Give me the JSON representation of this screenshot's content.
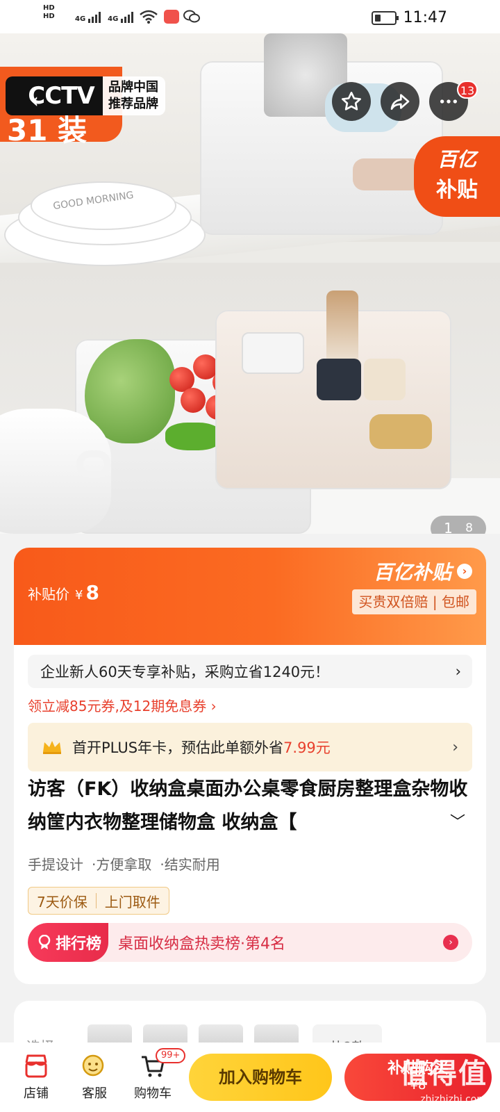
{
  "status_bar": {
    "hd1": "HD",
    "hd2": "HD",
    "net1": "4G",
    "net2": "4G",
    "time": "11:47"
  },
  "hero": {
    "cctv_logo": "CCTV",
    "cctv_line1": "品牌中国",
    "cctv_line2": "推荐品牌",
    "corner_text": "31 装",
    "plate_text": "GOOD MORNING",
    "notification_count": "13",
    "subsidy_line1": "百亿",
    "subsidy_line2": "补贴",
    "pager_current": "1",
    "pager_total": "8"
  },
  "price": {
    "label": "补贴价",
    "currency": "¥",
    "amount": "8",
    "brand": "百亿补贴",
    "guarantee": "买贵双倍赔 | 包邮"
  },
  "promo": {
    "enterprise": "企业新人60天专享补贴，采购立省1240元！",
    "coupon": "领立减85元券,及12期免息券 ›",
    "plus_prefix": "首开PLUS年卡，预估此单额外省",
    "plus_amount": "7.99元"
  },
  "product": {
    "title": "访客（FK）收纳盒桌面办公桌零食厨房整理盒杂物收纳筐内衣物整理储物盒 收纳盒【",
    "features": [
      "手提设计",
      "·方便拿取",
      "·结实耐用"
    ],
    "tags": [
      "7天价保",
      "上门取件"
    ],
    "rank_badge": "排行榜",
    "rank_text": "桌面收纳盒热卖榜·第4名"
  },
  "spec": {
    "label": "选择",
    "total": "共8款"
  },
  "bottom": {
    "shop": "店铺",
    "service": "客服",
    "cart": "购物车",
    "cart_count": "99+",
    "add_to_cart": "加入购物车",
    "buy_now": "补贴购买",
    "buy_price": "¥8"
  },
  "watermark": {
    "text": "值得值",
    "url": "zhizhizhi.com"
  },
  "colors": {
    "accent": "#f25a1e",
    "red": "#e8302d",
    "yellow": "#ffc61a"
  }
}
